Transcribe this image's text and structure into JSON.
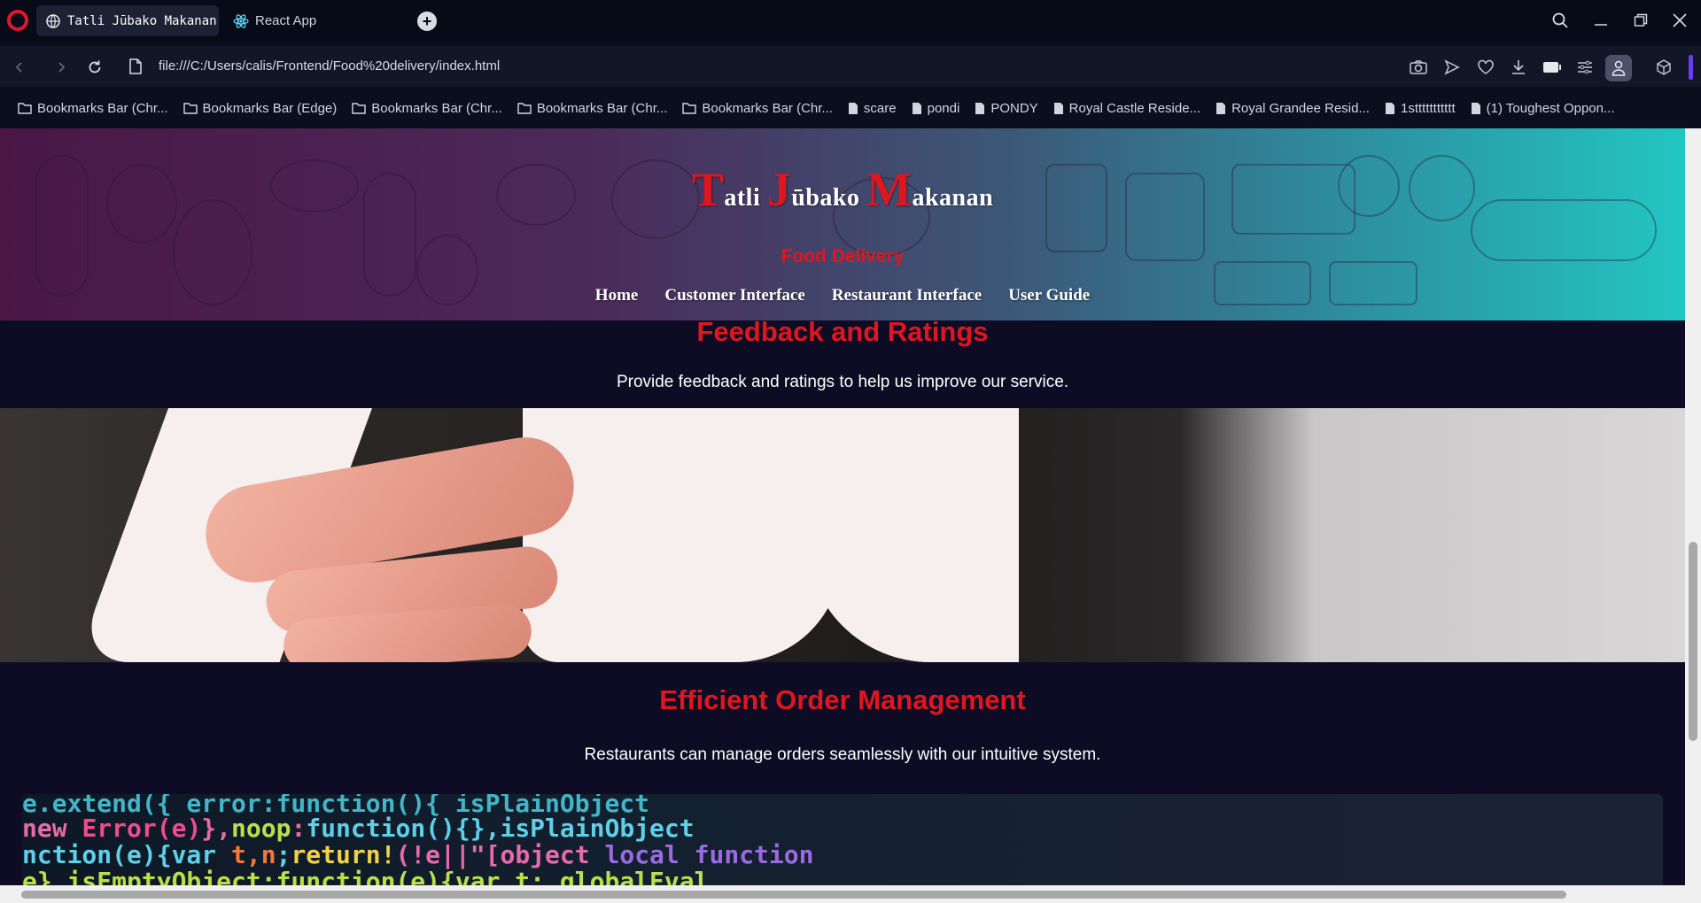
{
  "browser": {
    "tabs": [
      {
        "label": "Tatli Jūbako Makanan D",
        "active": true,
        "icon": "globe-icon"
      },
      {
        "label": "React App",
        "active": false,
        "icon": "react-icon"
      }
    ],
    "url": "file:///C:/Users/calis/Frontend/Food%20delivery/index.html",
    "bookmarks": [
      {
        "label": "Bookmarks Bar (Chr...",
        "icon": "folder-icon"
      },
      {
        "label": "Bookmarks Bar (Edge)",
        "icon": "folder-icon"
      },
      {
        "label": "Bookmarks Bar (Chr...",
        "icon": "folder-icon"
      },
      {
        "label": "Bookmarks Bar (Chr...",
        "icon": "folder-icon"
      },
      {
        "label": "Bookmarks Bar (Chr...",
        "icon": "folder-icon"
      },
      {
        "label": "scare",
        "icon": "file-icon"
      },
      {
        "label": "pondi",
        "icon": "file-icon"
      },
      {
        "label": "PONDY",
        "icon": "file-icon"
      },
      {
        "label": "Royal Castle Reside...",
        "icon": "file-icon"
      },
      {
        "label": "Royal Grandee Resid...",
        "icon": "file-icon"
      },
      {
        "label": "1sttttttttttt",
        "icon": "file-icon"
      },
      {
        "label": "(1) Toughest Oppon...",
        "icon": "file-icon"
      }
    ],
    "accent_color": "#6a3cf2"
  },
  "site": {
    "title": {
      "w1_initial": "T",
      "w1_rest": "atli ",
      "w2_initial": "J",
      "w2_rest": "ūbako ",
      "w3_initial": "M",
      "w3_rest": "akanan"
    },
    "subtitle": "Food Delivery",
    "nav": [
      "Home",
      "Customer Interface",
      "Restaurant Interface",
      "User Guide"
    ],
    "sections": [
      {
        "title": "Feedback and Ratings",
        "text": "Provide feedback and ratings to help us improve our service."
      },
      {
        "title": "Efficient Order Management",
        "text": "Restaurants can manage orders seamlessly with our intuitive system."
      }
    ],
    "colors": {
      "accent_red": "#e0161f",
      "background": "#0d0c24"
    }
  }
}
